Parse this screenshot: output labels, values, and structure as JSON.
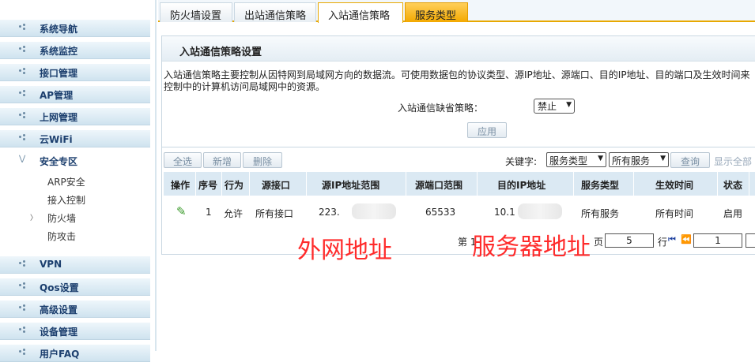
{
  "sidebar": {
    "items": [
      {
        "label": "系统导航"
      },
      {
        "label": "系统监控"
      },
      {
        "label": "接口管理"
      },
      {
        "label": "AP管理"
      },
      {
        "label": "上网管理"
      },
      {
        "label": "云WiFi"
      },
      {
        "label": "安全专区"
      },
      {
        "label": "VPN"
      },
      {
        "label": "Qos设置"
      },
      {
        "label": "高级设置"
      },
      {
        "label": "设备管理"
      },
      {
        "label": "用户FAQ"
      }
    ],
    "subitems": [
      {
        "label": "ARP安全"
      },
      {
        "label": "接入控制"
      },
      {
        "label": "防火墙"
      },
      {
        "label": "防攻击"
      }
    ]
  },
  "tabs": [
    {
      "label": "防火墙设置"
    },
    {
      "label": "出站通信策略"
    },
    {
      "label": "入站通信策略"
    },
    {
      "label": "服务类型"
    }
  ],
  "panel": {
    "title": "入站通信策略设置",
    "description": "入站通信策略主要控制从因特网到局域网方向的数据流。可使用数据包的协议类型、源IP地址、源端口、目的IP地址、目的端口及生效时间来控制中的计算机访问局域网中的资源。",
    "policy_label": "入站通信缺省策略：",
    "policy_value": "禁止",
    "apply_label": "应用"
  },
  "toolbar": {
    "select_all": "全选",
    "add": "新增",
    "delete": "删除",
    "keyword_label": "关键字:",
    "keyword_field": "服务类型",
    "keyword_value": "所有服务",
    "query": "查询",
    "show_all": "显示全部"
  },
  "table": {
    "headers": [
      "操作",
      "序号",
      "行为",
      "源接口",
      "源IP地址范围",
      "源端口范围",
      "目的IP地址",
      "服务类型",
      "生效时间",
      "状态"
    ],
    "row": {
      "index": "1",
      "action": "允许",
      "src_iface": "所有接口",
      "src_ip": "223.",
      "src_port": "65533",
      "dst_ip": "10.1",
      "service": "所有服务",
      "time": "所有时间",
      "status": "启用"
    }
  },
  "pager": {
    "prefix": "第 1",
    "per_page_suffix": "页",
    "rows_value": "5",
    "rows_suffix": "行",
    "page_value": "1"
  },
  "annotations": {
    "external": "外网地址",
    "server": "服务器地址"
  },
  "colors": {
    "accent": "#e8a800",
    "annotation": "#ff2b2b",
    "header_bg": "#dbe9f3"
  }
}
